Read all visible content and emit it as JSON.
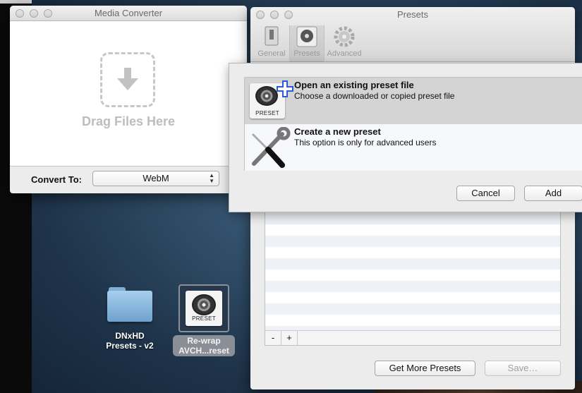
{
  "media_converter": {
    "title": "Media Converter",
    "drop_text": "Drag Files Here",
    "convert_label": "Convert To:",
    "format_value": "WebM"
  },
  "presets_window": {
    "title": "Presets",
    "toolbar": [
      {
        "label": "General",
        "icon": "switch-icon"
      },
      {
        "label": "Presets",
        "icon": "preset-reel-icon"
      },
      {
        "label": "Advanced",
        "icon": "gear-icon"
      }
    ],
    "list_controls": {
      "remove": "-",
      "add": "+"
    },
    "get_more_label": "Get More Presets",
    "save_label": "Save…"
  },
  "sheet": {
    "options": [
      {
        "title": "Open an existing preset file",
        "desc": "Choose a downloaded or copied preset file",
        "icon": "preset-add-icon",
        "badge": "PRESET"
      },
      {
        "title": "Create a new preset",
        "desc": "This option is only for advanced users",
        "icon": "tools-icon"
      }
    ],
    "cancel_label": "Cancel",
    "add_label": "Add"
  },
  "desktop": {
    "icons": [
      {
        "label_line1": "DNxHD",
        "label_line2": "Presets - v2",
        "icon": "folder-icon"
      },
      {
        "label_line1": "Re-wrap",
        "label_line2": "AVCH...reset",
        "icon": "preset-file-icon",
        "badge": "PRESET"
      }
    ]
  }
}
